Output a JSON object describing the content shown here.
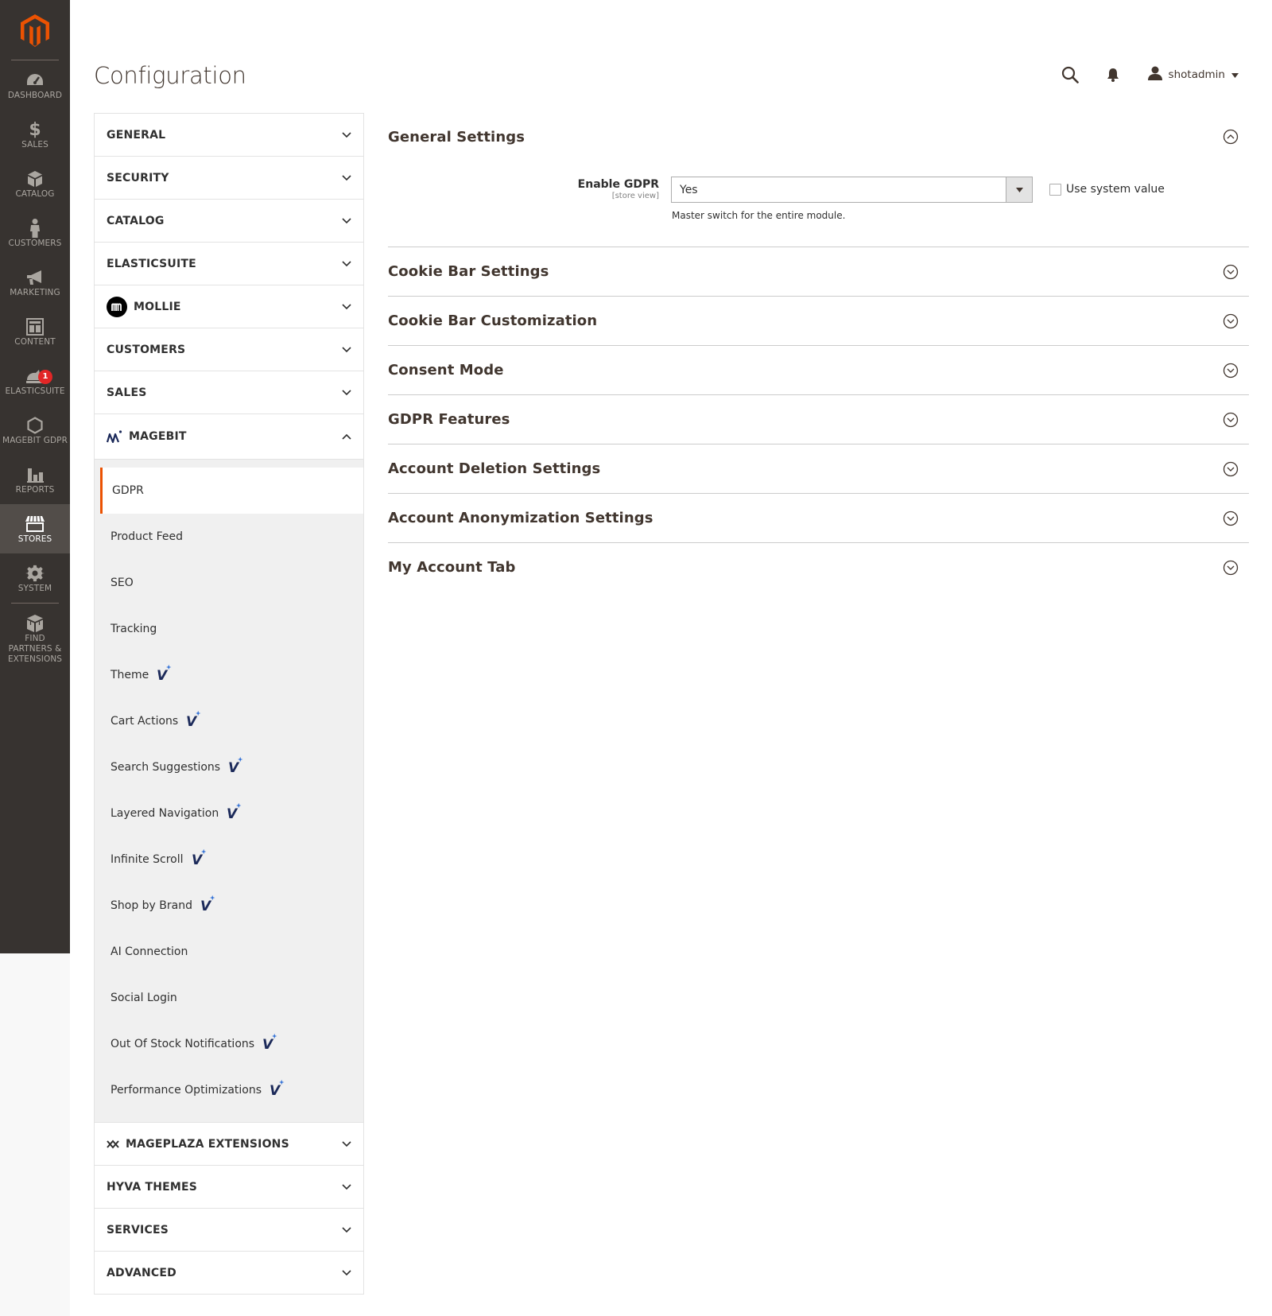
{
  "colors": {
    "menu_bg": "#373330",
    "menu_active_bg": "#524d49",
    "accent": "#eb5202",
    "badge": "#e22626",
    "vendor_blue": "#1c2a5a"
  },
  "admin_menu": {
    "logo": "magento-logo-icon",
    "items": [
      {
        "label": "DASHBOARD",
        "icon": "dashboard-icon"
      },
      {
        "label": "SALES",
        "icon": "dollar-icon"
      },
      {
        "label": "CATALOG",
        "icon": "box-icon"
      },
      {
        "label": "CUSTOMERS",
        "icon": "person-icon"
      },
      {
        "label": "MARKETING",
        "icon": "megaphone-icon"
      },
      {
        "label": "CONTENT",
        "icon": "layout-icon"
      },
      {
        "label": "ELASTICSUITE",
        "icon": "elasticsuite-icon",
        "badge": "1"
      },
      {
        "label": "MAGEBIT GDPR",
        "icon": "hexagon-icon"
      },
      {
        "label": "REPORTS",
        "icon": "bar-chart-icon"
      },
      {
        "label": "STORES",
        "icon": "store-icon"
      },
      {
        "label": "SYSTEM",
        "icon": "gear-icon"
      },
      {
        "label": "FIND PARTNERS & EXTENSIONS",
        "icon": "cubes-icon"
      }
    ]
  },
  "header": {
    "title": "Configuration",
    "user_name": "shotadmin"
  },
  "tabs": {
    "general": "GENERAL",
    "security": "SECURITY",
    "catalog": "CATALOG",
    "elasticsuite": "ELASTICSUITE",
    "mollie": "MOLLIE",
    "customers": "CUSTOMERS",
    "sales": "SALES",
    "magebit": "MAGEBIT",
    "mageplaza": "MAGEPLAZA EXTENSIONS",
    "hyva": "HYVA THEMES",
    "services": "SERVICES",
    "advanced": "ADVANCED"
  },
  "magebit_subtabs": [
    {
      "label": "GDPR"
    },
    {
      "label": "Product Feed"
    },
    {
      "label": "SEO"
    },
    {
      "label": "Tracking"
    },
    {
      "label": "Theme",
      "vendor_mark": "V"
    },
    {
      "label": "Cart Actions",
      "vendor_mark": "V"
    },
    {
      "label": "Search Suggestions",
      "vendor_mark": "V"
    },
    {
      "label": "Layered Navigation",
      "vendor_mark": "V"
    },
    {
      "label": "Infinite Scroll",
      "vendor_mark": "V"
    },
    {
      "label": "Shop by Brand",
      "vendor_mark": "V"
    },
    {
      "label": "AI Connection"
    },
    {
      "label": "Social Login"
    },
    {
      "label": "Out Of Stock Notifications",
      "vendor_mark": "V"
    },
    {
      "label": "Performance Optimizations",
      "vendor_mark": "V"
    }
  ],
  "sections": {
    "general_settings": {
      "title": "General Settings",
      "field_label": "Enable GDPR",
      "field_scope": "[store view]",
      "field_value": "Yes",
      "field_note": "Master switch for the entire module.",
      "use_system_value_label": "Use system value",
      "use_system_value_checked": false
    },
    "cookie_bar_settings": "Cookie Bar Settings",
    "cookie_bar_customization": "Cookie Bar Customization",
    "consent_mode": "Consent Mode",
    "gdpr_features": "GDPR Features",
    "account_deletion": "Account Deletion Settings",
    "account_anonymization": "Account Anonymization Settings",
    "my_account_tab": "My Account Tab"
  }
}
